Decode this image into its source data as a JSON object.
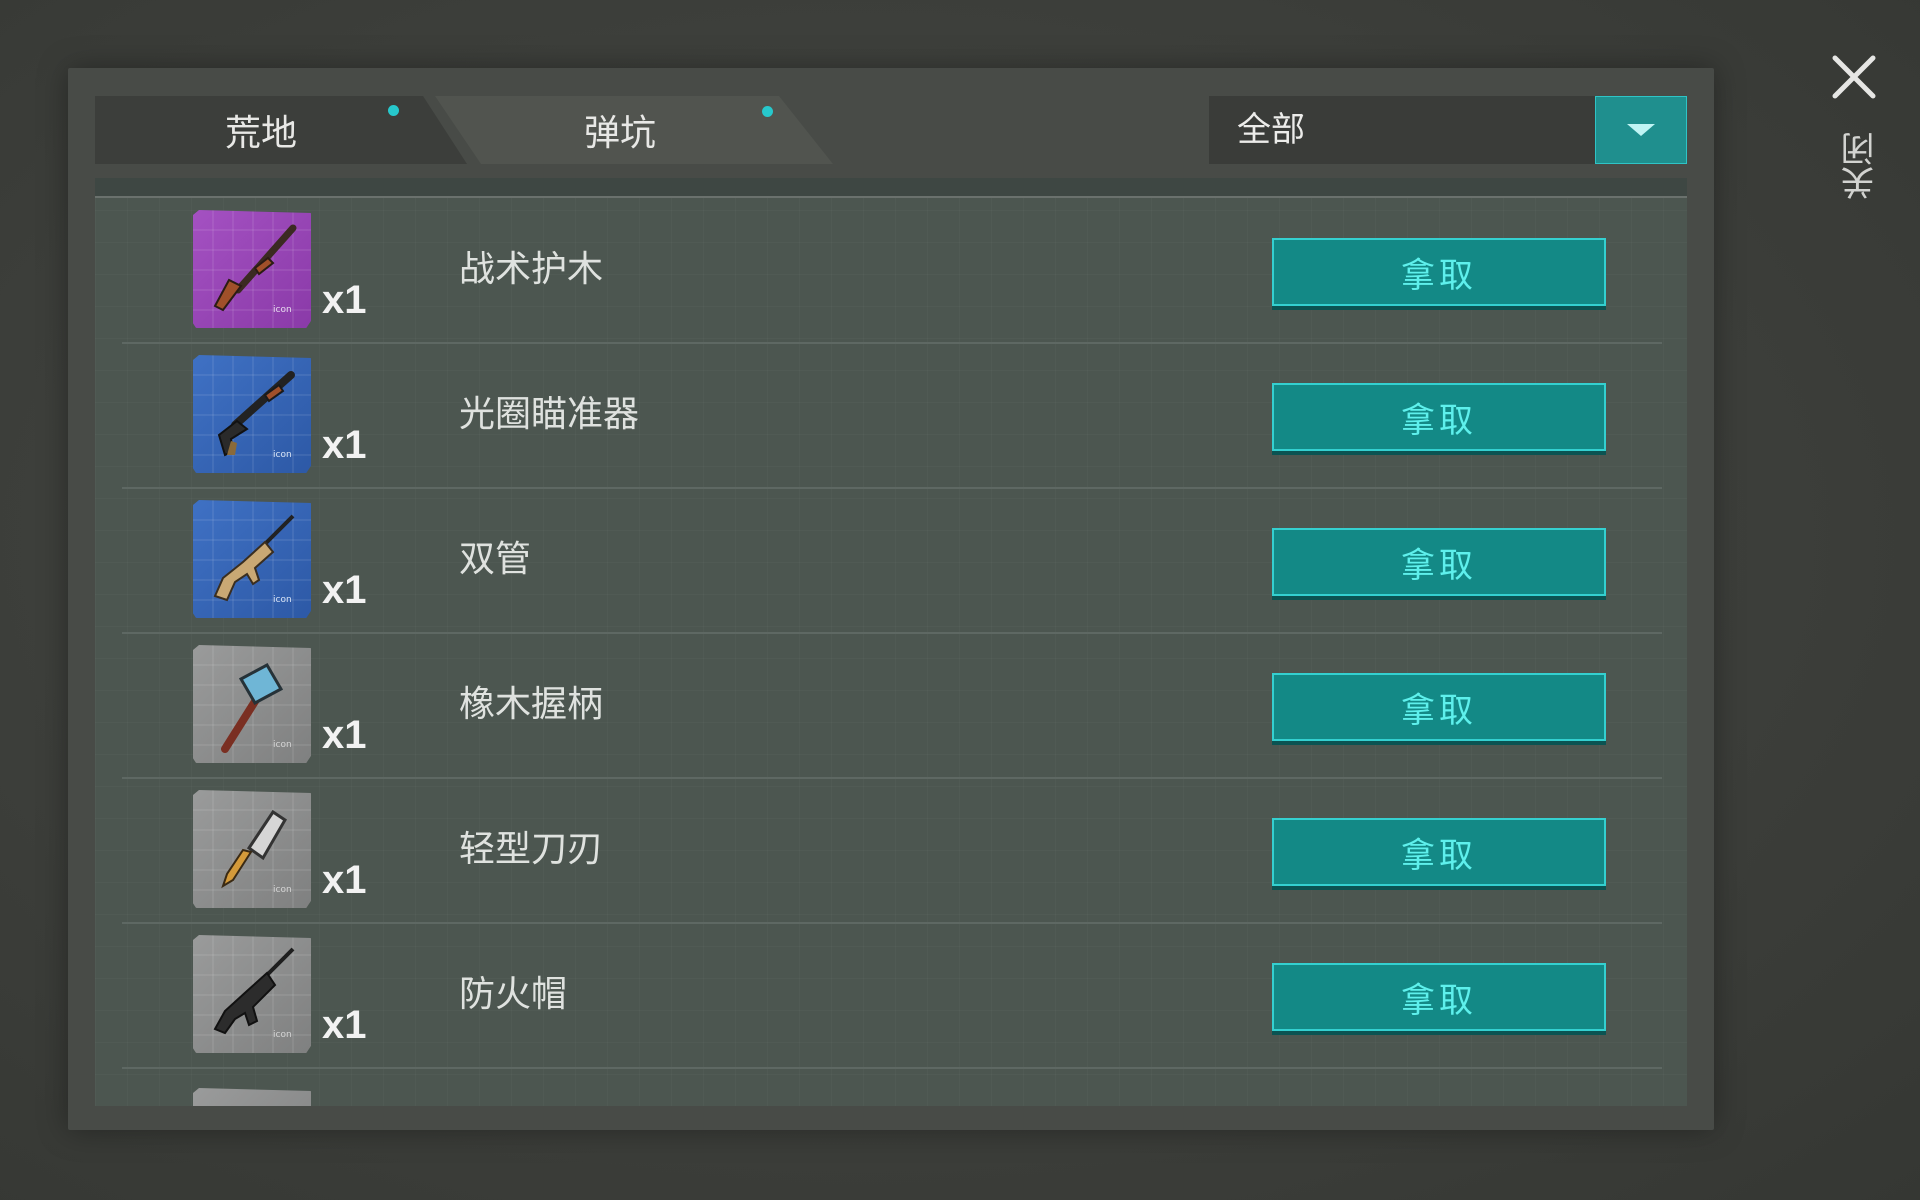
{
  "tabs": [
    {
      "label": "荒地",
      "active": true,
      "has_notification": true
    },
    {
      "label": "弹坑",
      "active": false,
      "has_notification": true
    }
  ],
  "filter": {
    "selected": "全部"
  },
  "close": {
    "label": "关闭"
  },
  "items": [
    {
      "name": "战术护木",
      "quantity": "x1",
      "action": "拿取",
      "rarity": "purple",
      "icon": "shotgun-icon"
    },
    {
      "name": "光圈瞄准器",
      "quantity": "x1",
      "action": "拿取",
      "rarity": "blue",
      "icon": "pump-shotgun-icon"
    },
    {
      "name": "双管",
      "quantity": "x1",
      "action": "拿取",
      "rarity": "blue",
      "icon": "assault-rifle-icon"
    },
    {
      "name": "橡木握柄",
      "quantity": "x1",
      "action": "拿取",
      "rarity": "gray",
      "icon": "hammer-icon"
    },
    {
      "name": "轻型刀刃",
      "quantity": "x1",
      "action": "拿取",
      "rarity": "gray",
      "icon": "cleaver-icon"
    },
    {
      "name": "防火帽",
      "quantity": "x1",
      "action": "拿取",
      "rarity": "gray",
      "icon": "rifle-icon"
    }
  ],
  "colors": {
    "accent": "#138986",
    "accent_border": "#34d0d0",
    "button_text": "#5ef0ec",
    "notification_dot": "#27c8cc"
  }
}
